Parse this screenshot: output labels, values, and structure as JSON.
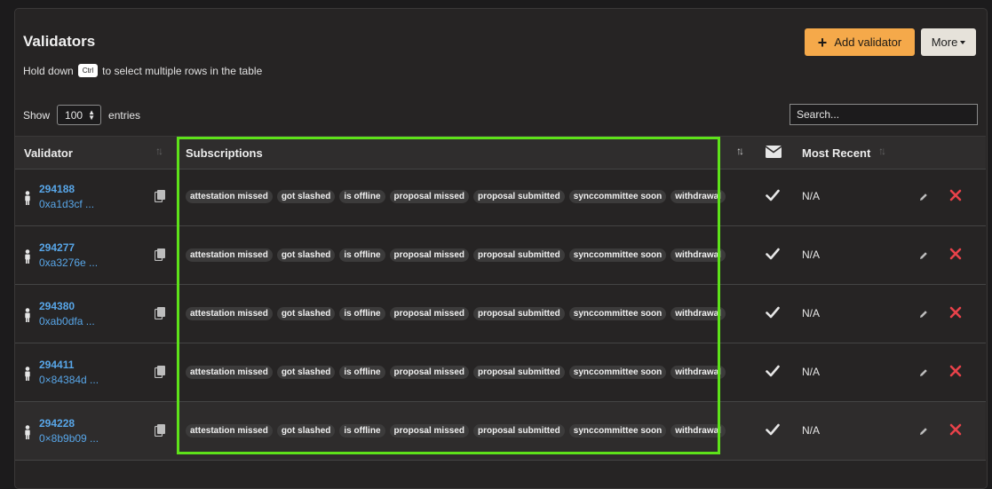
{
  "header": {
    "title": "Validators",
    "hint_before": "Hold down",
    "hint_key": "Ctrl",
    "hint_after": "to select multiple rows in the table",
    "add_button_label": "Add validator",
    "more_button_label": "More"
  },
  "controls": {
    "show_label": "Show",
    "page_size": "100",
    "entries_label": "entries",
    "search_placeholder": "Search..."
  },
  "columns": {
    "validator": "Validator",
    "subscriptions": "Subscriptions",
    "most_recent": "Most Recent"
  },
  "icons": {
    "sort": "sort-icon",
    "email": "envelope-icon",
    "person": "person-icon",
    "copy": "copy-icon",
    "check": "check-icon",
    "edit": "pencil-icon",
    "delete": "x-icon"
  },
  "colors": {
    "accent": "#f5a94a",
    "link": "#58a6e8",
    "delete": "#e8424a",
    "highlight": "#5ee21a"
  },
  "rows": [
    {
      "id": "294188",
      "address": "0xa1d3cf ...",
      "tags": [
        "attestation missed",
        "got slashed",
        "is offline",
        "proposal missed",
        "proposal submitted",
        "synccommittee soon",
        "withdrawal"
      ],
      "most_recent": "N/A"
    },
    {
      "id": "294277",
      "address": "0xa3276e ...",
      "tags": [
        "attestation missed",
        "got slashed",
        "is offline",
        "proposal missed",
        "proposal submitted",
        "synccommittee soon",
        "withdrawal"
      ],
      "most_recent": "N/A"
    },
    {
      "id": "294380",
      "address": "0xab0dfa ...",
      "tags": [
        "attestation missed",
        "got slashed",
        "is offline",
        "proposal missed",
        "proposal submitted",
        "synccommittee soon",
        "withdrawal"
      ],
      "most_recent": "N/A"
    },
    {
      "id": "294411",
      "address": "0×84384d ...",
      "tags": [
        "attestation missed",
        "got slashed",
        "is offline",
        "proposal missed",
        "proposal submitted",
        "synccommittee soon",
        "withdrawal"
      ],
      "most_recent": "N/A"
    },
    {
      "id": "294228",
      "address": "0×8b9b09 ...",
      "tags": [
        "attestation missed",
        "got slashed",
        "is offline",
        "proposal missed",
        "proposal submitted",
        "synccommittee soon",
        "withdrawal"
      ],
      "most_recent": "N/A"
    }
  ]
}
